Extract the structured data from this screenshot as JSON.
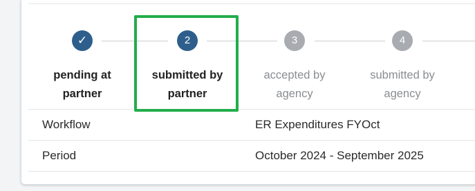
{
  "colors": {
    "completed_step": "#2e5f8c",
    "current_step": "#2e5f8c",
    "upcoming_step": "#a8abb0",
    "highlight_border": "#22ad4b"
  },
  "steps": [
    {
      "marker": "✓",
      "icon": "checkmark-icon",
      "state": "completed",
      "label_line1": "pending at",
      "label_line2": "partner"
    },
    {
      "marker": "2",
      "state": "current",
      "label_line1": "submitted by",
      "label_line2": "partner"
    },
    {
      "marker": "3",
      "state": "upcoming",
      "label_line1": "accepted by",
      "label_line2": "agency"
    },
    {
      "marker": "4",
      "state": "upcoming",
      "label_line1": "submitted by",
      "label_line2": "agency"
    }
  ],
  "details": [
    {
      "label": "Workflow",
      "value": "ER Expenditures FYOct"
    },
    {
      "label": "Period",
      "value": "October 2024 - September 2025"
    }
  ]
}
